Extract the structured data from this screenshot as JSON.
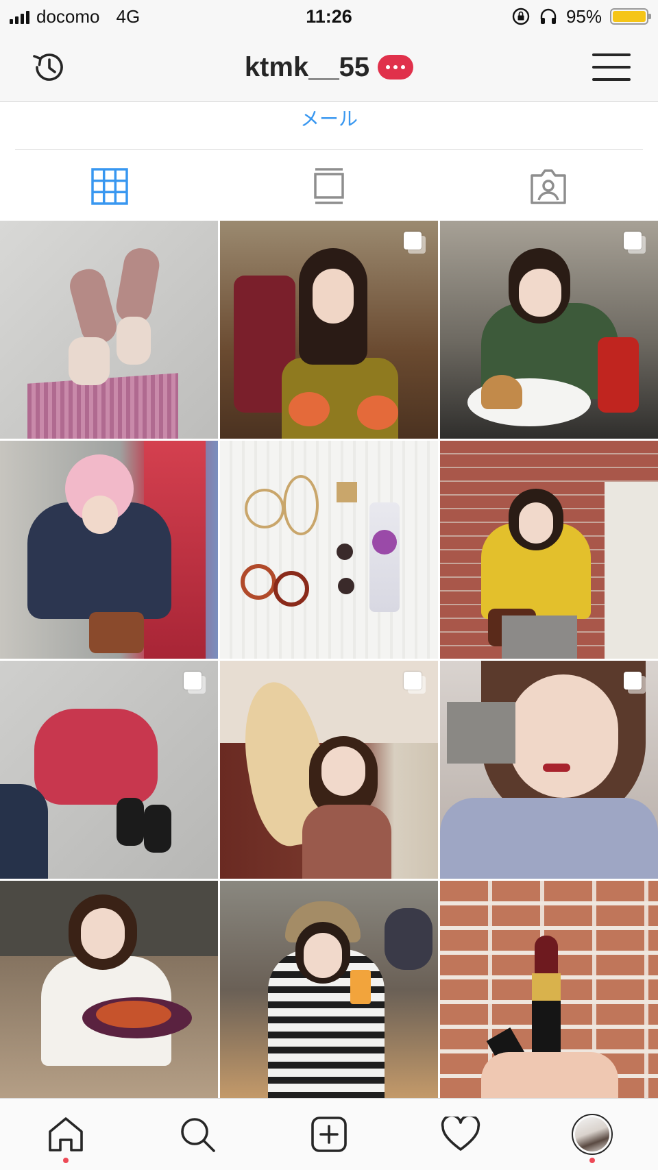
{
  "status_bar": {
    "carrier": "docomo",
    "network": "4G",
    "time": "11:26",
    "battery": "95%",
    "battery_level": 0.95,
    "icons": [
      "signal-icon",
      "rotation-lock-icon",
      "headphones-icon",
      "battery-icon"
    ]
  },
  "header": {
    "username": "ktmk__55",
    "history_icon": "history-icon",
    "dm_badge_icon": "more-dots-icon",
    "menu_icon": "hamburger-menu-icon"
  },
  "profile": {
    "email_link": "メール"
  },
  "tabs": [
    {
      "name": "grid-view",
      "icon": "grid-icon",
      "active": true
    },
    {
      "name": "feed-view",
      "icon": "feed-icon",
      "active": false
    },
    {
      "name": "tagged",
      "icon": "tagged-person-icon",
      "active": false
    }
  ],
  "active_color": "#3897f0",
  "posts": [
    {
      "multi": false
    },
    {
      "multi": true
    },
    {
      "multi": true
    },
    {
      "multi": false
    },
    {
      "multi": false
    },
    {
      "multi": false
    },
    {
      "multi": true
    },
    {
      "multi": true
    },
    {
      "multi": true
    },
    {
      "multi": false
    },
    {
      "multi": false
    },
    {
      "multi": false
    }
  ],
  "bottom_nav": [
    {
      "name": "home",
      "icon": "home-icon",
      "notify": true
    },
    {
      "name": "search",
      "icon": "search-icon",
      "notify": false
    },
    {
      "name": "new-post",
      "icon": "add-post-icon",
      "notify": false
    },
    {
      "name": "activity",
      "icon": "heart-icon",
      "notify": false
    },
    {
      "name": "profile",
      "icon": "profile-avatar-icon",
      "notify": true
    }
  ]
}
